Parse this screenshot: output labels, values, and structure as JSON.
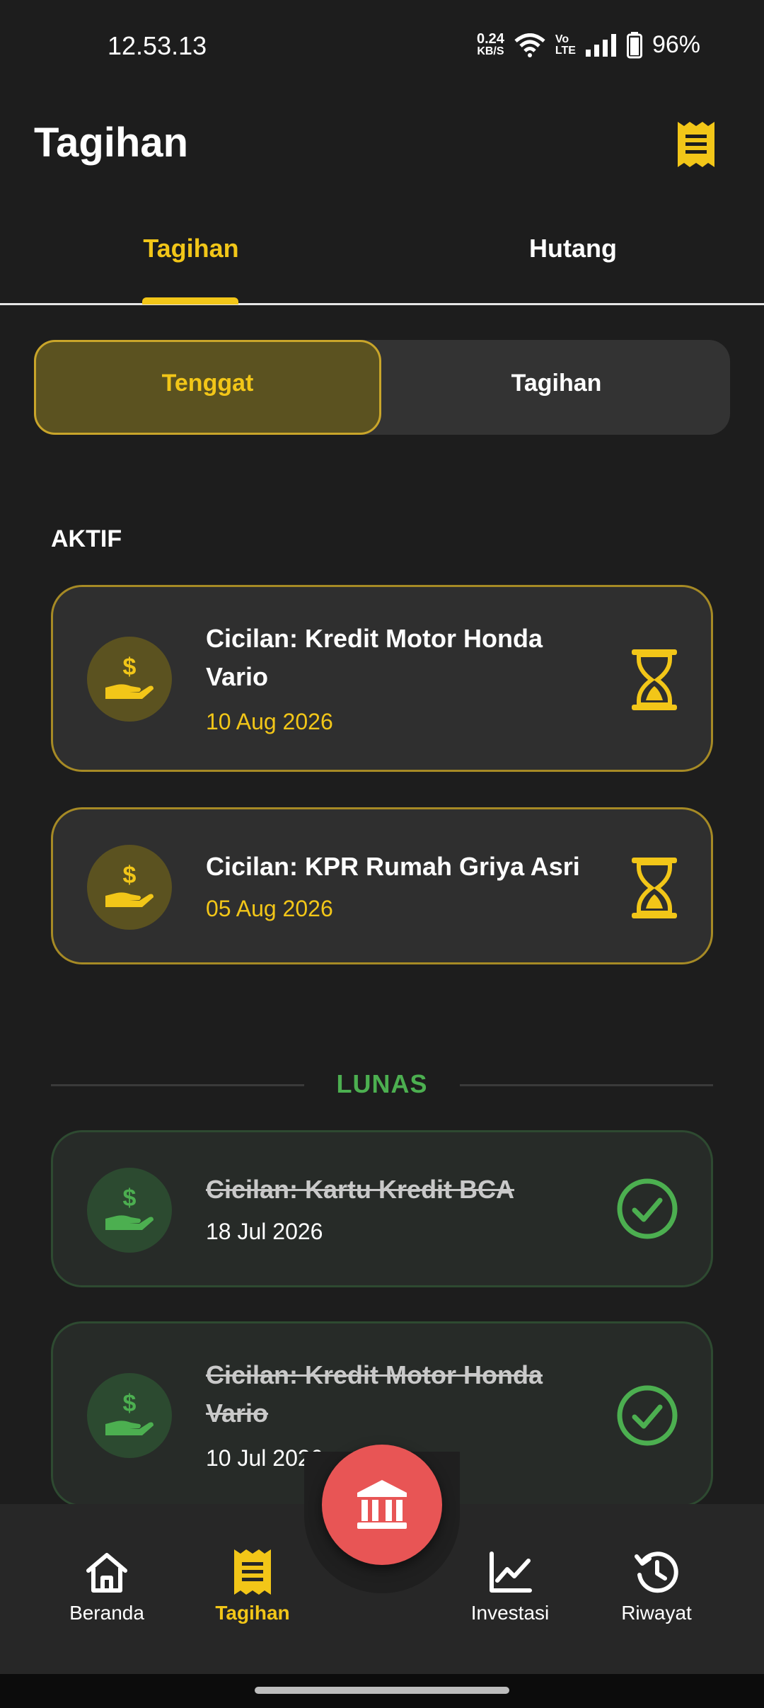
{
  "status_bar": {
    "time": "12.53.13",
    "speed_value": "0.24",
    "speed_unit": "KB/S",
    "volte_top": "Vo",
    "volte_bottom": "LTE",
    "battery": "96%"
  },
  "header": {
    "title": "Tagihan",
    "icon": "receipt-icon"
  },
  "tabs": [
    {
      "label": "Tagihan",
      "active": true
    },
    {
      "label": "Hutang",
      "active": false
    }
  ],
  "segment": {
    "options": [
      "Tenggat",
      "Tagihan"
    ],
    "selected": "Tenggat"
  },
  "sections": {
    "active_title": "AKTIF",
    "paid_title": "LUNAS"
  },
  "active_bills": [
    {
      "title": "Cicilan: Kredit Motor Honda Vario",
      "date": "10 Aug 2026",
      "status_icon": "hourglass-icon"
    },
    {
      "title": "Cicilan: KPR Rumah Griya Asri",
      "date": "05 Aug 2026",
      "status_icon": "hourglass-icon"
    }
  ],
  "paid_bills": [
    {
      "title": "Cicilan: Kartu Kredit BCA",
      "date": "18 Jul 2026",
      "status_icon": "check-circle-icon"
    },
    {
      "title": "Cicilan: Kredit Motor Honda Vario",
      "date": "10 Jul 2026",
      "status_icon": "check-circle-icon"
    }
  ],
  "bottom_nav": [
    {
      "label": "Beranda",
      "icon": "home-icon",
      "active": false
    },
    {
      "label": "Tagihan",
      "icon": "receipt-icon",
      "active": true
    },
    {
      "label": "Investasi",
      "icon": "chart-line-icon",
      "active": false
    },
    {
      "label": "Riwayat",
      "icon": "history-icon",
      "active": false
    }
  ],
  "fab": {
    "icon": "bank-icon"
  },
  "colors": {
    "accent": "#f2c618",
    "paid": "#4caf50",
    "fab": "#e85555",
    "background": "#1d1d1d"
  }
}
